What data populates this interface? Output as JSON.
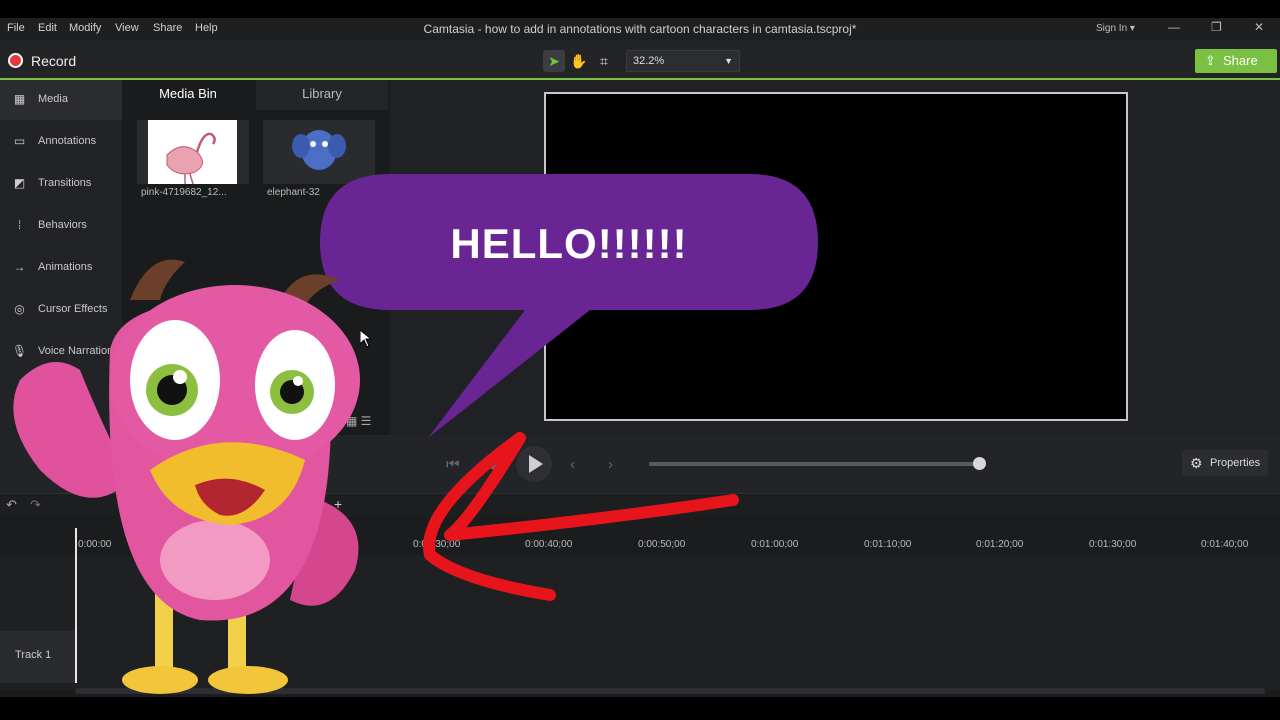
{
  "menubar": {
    "items": [
      "File",
      "Edit",
      "Modify",
      "View",
      "Share",
      "Help"
    ],
    "title": "Camtasia - how to add in annotations with cartoon characters in camtasia.tscproj*",
    "signin": "Sign In ▾",
    "controls": [
      "—",
      "❐",
      "✕"
    ]
  },
  "toolbar": {
    "record_label": "Record",
    "zoom_value": "32.2%",
    "share_label": "Share",
    "accent": "#7ac143",
    "record_color": "#e5393b"
  },
  "sidebar": {
    "items": [
      {
        "label": "Media",
        "icon": "film-icon"
      },
      {
        "label": "Annotations",
        "icon": "annotation-icon"
      },
      {
        "label": "Transitions",
        "icon": "transition-icon"
      },
      {
        "label": "Behaviors",
        "icon": "behaviors-icon"
      },
      {
        "label": "Animations",
        "icon": "animation-icon"
      },
      {
        "label": "Cursor Effects",
        "icon": "cursor-effects-icon"
      },
      {
        "label": "Voice Narration",
        "icon": "microphone-icon"
      }
    ]
  },
  "media": {
    "tabs": [
      "Media Bin",
      "Library"
    ],
    "items": [
      {
        "caption": "pink-4719682_12...",
        "icon": "flamingo-thumbnail"
      },
      {
        "caption": "elephant-32",
        "icon": "elephant-thumbnail"
      }
    ]
  },
  "annotation": {
    "text": "HELLO!!!!!!",
    "bubble_color": "#6a2595",
    "arrow_color": "#e8141c"
  },
  "playback": {
    "properties_label": "Properties",
    "scrub_position": 1.0
  },
  "timeline": {
    "ticks": [
      "0:00:00",
      "0:00:30;00",
      "0:00:40;00",
      "0:00:50;00",
      "0:01:00;00",
      "0:01:10;00",
      "0:01:20;00",
      "0:01:30;00",
      "0:01:40;00"
    ],
    "track_label": "Track 1"
  }
}
